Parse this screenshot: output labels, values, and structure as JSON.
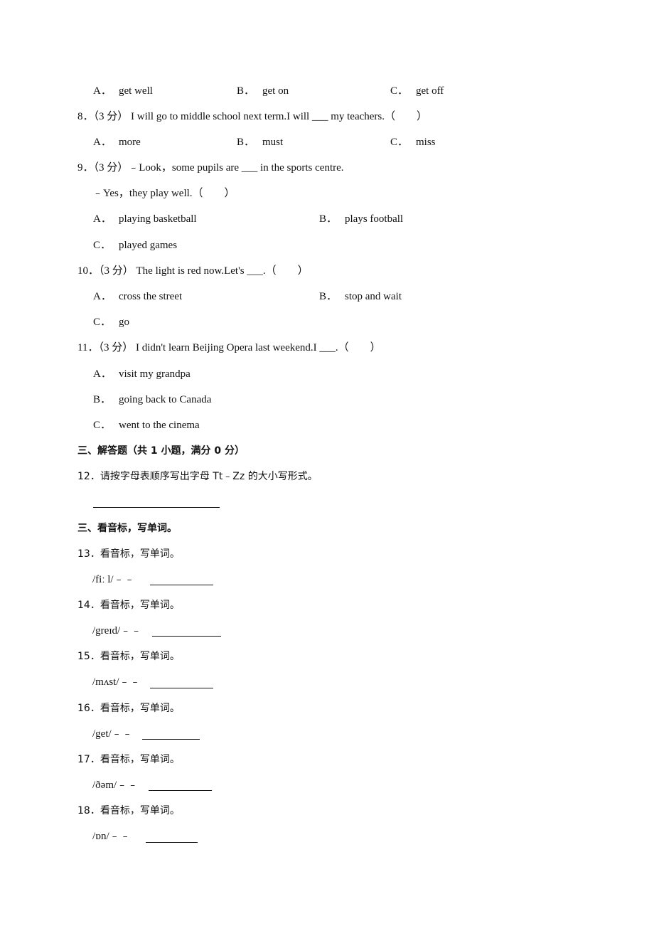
{
  "q7_options": {
    "A": {
      "letter": "A．",
      "text": "get well"
    },
    "B": {
      "letter": "B．",
      "text": "get on"
    },
    "C": {
      "letter": "C．",
      "text": "get off"
    }
  },
  "q8": {
    "stem": "8．（3 分） I will go to middle school next term.I will ___ my teachers.（　　）",
    "A": {
      "letter": "A．",
      "text": "more"
    },
    "B": {
      "letter": "B．",
      "text": "must"
    },
    "C": {
      "letter": "C．",
      "text": "miss"
    }
  },
  "q9": {
    "stem": "9．（3 分）﹣Look，some pupils are ___ in the sports centre.",
    "stem2": "﹣Yes，they play well.（　　）",
    "A": {
      "letter": "A．",
      "text": "playing basketball"
    },
    "B": {
      "letter": "B．",
      "text": "plays football"
    },
    "C": {
      "letter": "C．",
      "text": "played games"
    }
  },
  "q10": {
    "stem": "10．（3 分） The light is red now.Let's ___.（　　）",
    "A": {
      "letter": "A．",
      "text": "cross the street"
    },
    "B": {
      "letter": "B．",
      "text": "stop and wait"
    },
    "C": {
      "letter": "C．",
      "text": "go"
    }
  },
  "q11": {
    "stem": "11．（3 分） I didn't learn Beijing Opera last weekend.I ___.（　　）",
    "A": {
      "letter": "A．",
      "text": "visit my grandpa"
    },
    "B": {
      "letter": "B．",
      "text": "going back to Canada"
    },
    "C": {
      "letter": "C．",
      "text": "went to the cinema"
    }
  },
  "section3a": {
    "title": "三、解答题（共 1 小题，满分 0 分）"
  },
  "q12": {
    "stem": "12．请按字母表顺序写出字母 Tt﹣Zz 的大小写形式。"
  },
  "section3b": {
    "title": "三、看音标，写单词。"
  },
  "phonetics": [
    {
      "stem": "13．看音标，写单词。",
      "ipa": "/fiː l/﹣﹣"
    },
    {
      "stem": "14．看音标，写单词。",
      "ipa": "/greɪd/﹣﹣"
    },
    {
      "stem": "15．看音标，写单词。",
      "ipa": "/mʌst/﹣﹣"
    },
    {
      "stem": "16．看音标，写单词。",
      "ipa": "/get/﹣﹣"
    },
    {
      "stem": "17．看音标，写单词。",
      "ipa": "/ðəm/﹣﹣"
    },
    {
      "stem": "18．看音标，写单词。",
      "ipa": "/ɒn/﹣﹣"
    }
  ]
}
